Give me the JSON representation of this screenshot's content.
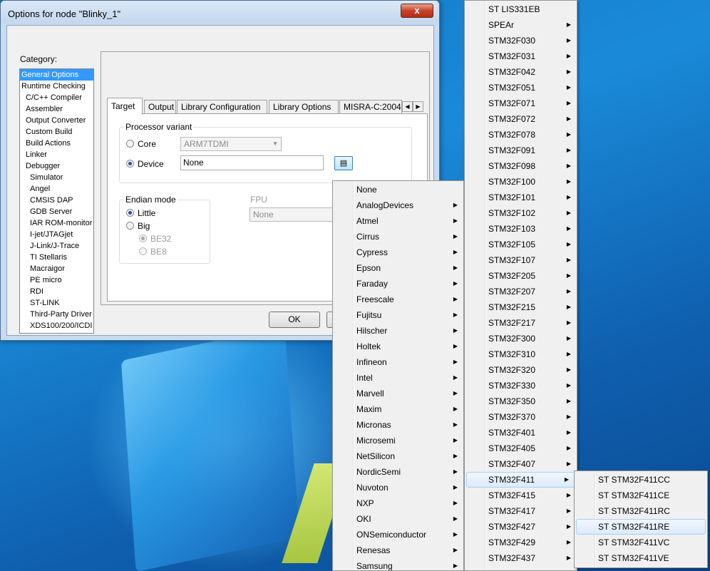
{
  "dialog": {
    "title": "Options for node \"Blinky_1\"",
    "close_glyph": "x",
    "category_label": "Category:",
    "categories": [
      {
        "label": "General Options",
        "level": 0,
        "selected": true
      },
      {
        "label": "Runtime Checking",
        "level": 0
      },
      {
        "label": "C/C++ Compiler",
        "level": 1
      },
      {
        "label": "Assembler",
        "level": 1
      },
      {
        "label": "Output Converter",
        "level": 1
      },
      {
        "label": "Custom Build",
        "level": 1
      },
      {
        "label": "Build Actions",
        "level": 1
      },
      {
        "label": "Linker",
        "level": 1
      },
      {
        "label": "Debugger",
        "level": 1
      },
      {
        "label": "Simulator",
        "level": 2
      },
      {
        "label": "Angel",
        "level": 2
      },
      {
        "label": "CMSIS DAP",
        "level": 2
      },
      {
        "label": "GDB Server",
        "level": 2
      },
      {
        "label": "IAR ROM-monitor",
        "level": 2
      },
      {
        "label": "I-jet/JTAGjet",
        "level": 2
      },
      {
        "label": "J-Link/J-Trace",
        "level": 2
      },
      {
        "label": "TI Stellaris",
        "level": 2
      },
      {
        "label": "Macraigor",
        "level": 2
      },
      {
        "label": "PE micro",
        "level": 2
      },
      {
        "label": "RDI",
        "level": 2
      },
      {
        "label": "ST-LINK",
        "level": 2
      },
      {
        "label": "Third-Party Driver",
        "level": 2
      },
      {
        "label": "XDS100/200/ICDI",
        "level": 2
      }
    ],
    "tabs": [
      "Target",
      "Output",
      "Library Configuration",
      "Library Options",
      "MISRA-C:2004"
    ],
    "active_tab": "Target",
    "processor_variant": {
      "label": "Processor variant",
      "core_label": "Core",
      "core_value": "ARM7TDMI",
      "device_label": "Device",
      "device_value": "None",
      "selected": "Device"
    },
    "endian": {
      "label": "Endian mode",
      "little": "Little",
      "big": "Big",
      "be32": "BE32",
      "be8": "BE8",
      "selected": "Little"
    },
    "fpu": {
      "label": "FPU",
      "value": "None"
    },
    "ok_label": "OK"
  },
  "vendor_menu": [
    {
      "label": "None",
      "sub": false
    },
    {
      "label": "AnalogDevices",
      "sub": true
    },
    {
      "label": "Atmel",
      "sub": true
    },
    {
      "label": "Cirrus",
      "sub": true
    },
    {
      "label": "Cypress",
      "sub": true
    },
    {
      "label": "Epson",
      "sub": true
    },
    {
      "label": "Faraday",
      "sub": true
    },
    {
      "label": "Freescale",
      "sub": true
    },
    {
      "label": "Fujitsu",
      "sub": true
    },
    {
      "label": "Hilscher",
      "sub": true
    },
    {
      "label": "Holtek",
      "sub": true
    },
    {
      "label": "Infineon",
      "sub": true
    },
    {
      "label": "Intel",
      "sub": true
    },
    {
      "label": "Marvell",
      "sub": true
    },
    {
      "label": "Maxim",
      "sub": true
    },
    {
      "label": "Micronas",
      "sub": true
    },
    {
      "label": "Microsemi",
      "sub": true
    },
    {
      "label": "NetSilicon",
      "sub": true
    },
    {
      "label": "NordicSemi",
      "sub": true
    },
    {
      "label": "Nuvoton",
      "sub": true
    },
    {
      "label": "NXP",
      "sub": true
    },
    {
      "label": "OKI",
      "sub": true
    },
    {
      "label": "ONSemiconductor",
      "sub": true
    },
    {
      "label": "Renesas",
      "sub": true
    },
    {
      "label": "Samsung",
      "sub": true
    }
  ],
  "st_menu": [
    {
      "label": "ST LIS331EB",
      "sub": false
    },
    {
      "label": "SPEAr",
      "sub": true
    },
    {
      "label": "STM32F030",
      "sub": true
    },
    {
      "label": "STM32F031",
      "sub": true
    },
    {
      "label": "STM32F042",
      "sub": true
    },
    {
      "label": "STM32F051",
      "sub": true
    },
    {
      "label": "STM32F071",
      "sub": true
    },
    {
      "label": "STM32F072",
      "sub": true
    },
    {
      "label": "STM32F078",
      "sub": true
    },
    {
      "label": "STM32F091",
      "sub": true
    },
    {
      "label": "STM32F098",
      "sub": true
    },
    {
      "label": "STM32F100",
      "sub": true
    },
    {
      "label": "STM32F101",
      "sub": true
    },
    {
      "label": "STM32F102",
      "sub": true
    },
    {
      "label": "STM32F103",
      "sub": true
    },
    {
      "label": "STM32F105",
      "sub": true
    },
    {
      "label": "STM32F107",
      "sub": true
    },
    {
      "label": "STM32F205",
      "sub": true
    },
    {
      "label": "STM32F207",
      "sub": true
    },
    {
      "label": "STM32F215",
      "sub": true
    },
    {
      "label": "STM32F217",
      "sub": true
    },
    {
      "label": "STM32F300",
      "sub": true
    },
    {
      "label": "STM32F310",
      "sub": true
    },
    {
      "label": "STM32F320",
      "sub": true
    },
    {
      "label": "STM32F330",
      "sub": true
    },
    {
      "label": "STM32F350",
      "sub": true
    },
    {
      "label": "STM32F370",
      "sub": true
    },
    {
      "label": "STM32F401",
      "sub": true
    },
    {
      "label": "STM32F405",
      "sub": true
    },
    {
      "label": "STM32F407",
      "sub": true
    },
    {
      "label": "STM32F411",
      "sub": true,
      "highlighted": true
    },
    {
      "label": "STM32F415",
      "sub": true
    },
    {
      "label": "STM32F417",
      "sub": true
    },
    {
      "label": "STM32F427",
      "sub": true
    },
    {
      "label": "STM32F429",
      "sub": true
    },
    {
      "label": "STM32F437",
      "sub": true
    }
  ],
  "f411_menu": [
    {
      "label": "ST STM32F411CC"
    },
    {
      "label": "ST STM32F411CE"
    },
    {
      "label": "ST STM32F411RC"
    },
    {
      "label": "ST STM32F411RE",
      "highlighted": true
    },
    {
      "label": "ST STM32F411VC"
    },
    {
      "label": "ST STM32F411VE"
    }
  ]
}
